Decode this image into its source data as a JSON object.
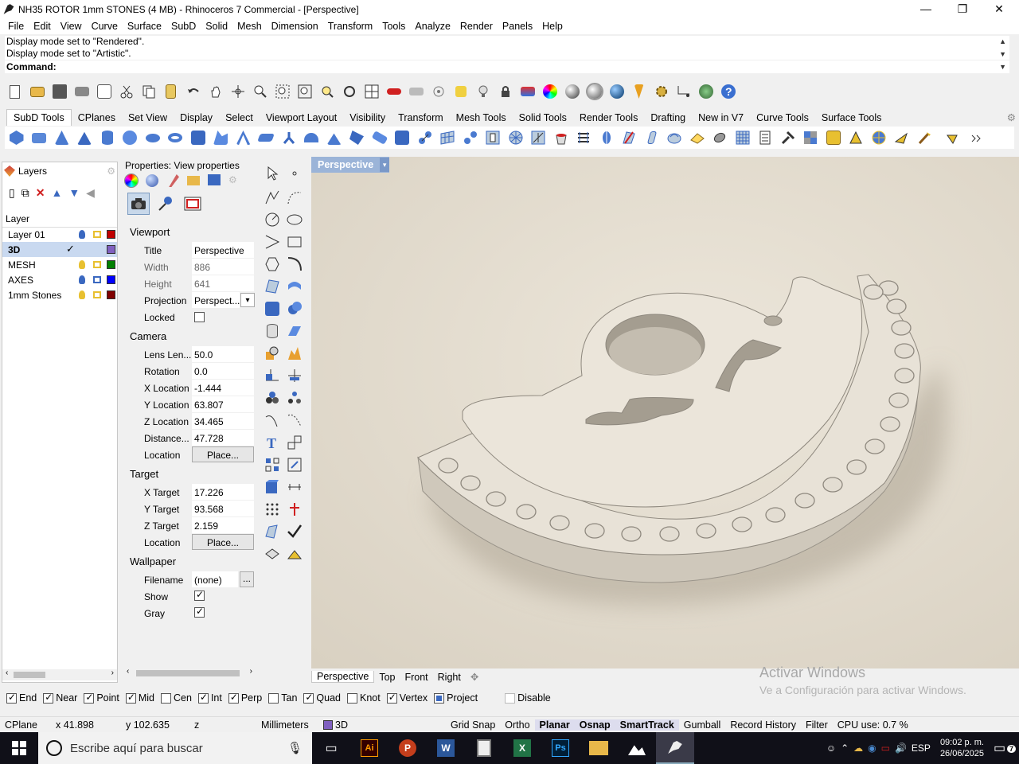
{
  "window": {
    "title": "NH35 ROTOR 1mm STONES (4 MB) - Rhinoceros 7 Commercial - [Perspective]",
    "minimize": "—",
    "maximize": "❐",
    "close": "✕"
  },
  "menu": [
    "File",
    "Edit",
    "View",
    "Curve",
    "Surface",
    "SubD",
    "Solid",
    "Mesh",
    "Dimension",
    "Transform",
    "Tools",
    "Analyze",
    "Render",
    "Panels",
    "Help"
  ],
  "command_history": [
    "Display mode set to \"Rendered\".",
    "Display mode set to \"Artistic\"."
  ],
  "command_prompt": "Command:",
  "toolbar_tabs": [
    "SubD Tools",
    "CPlanes",
    "Set View",
    "Display",
    "Select",
    "Viewport Layout",
    "Visibility",
    "Transform",
    "Mesh Tools",
    "Solid Tools",
    "Render Tools",
    "Drafting",
    "New in V7",
    "Curve Tools",
    "Surface Tools"
  ],
  "layers_panel": {
    "title": "Layers",
    "header": "Layer",
    "rows": [
      {
        "name": "Layer 01",
        "color": "#c00000",
        "current": false
      },
      {
        "name": "3D",
        "color": "#8060c0",
        "current": true
      },
      {
        "name": "MESH",
        "color": "#008000",
        "current": false
      },
      {
        "name": "AXES",
        "color": "#0000ff",
        "current": false
      },
      {
        "name": "1mm Stones",
        "color": "#800000",
        "current": false
      }
    ]
  },
  "properties": {
    "title": "Properties: View properties",
    "viewport_section": "Viewport",
    "title_label": "Title",
    "title_value": "Perspective",
    "width_label": "Width",
    "width_value": "886",
    "height_label": "Height",
    "height_value": "641",
    "projection_label": "Projection",
    "projection_value": "Perspect...",
    "locked_label": "Locked",
    "camera_section": "Camera",
    "lens_label": "Lens Len...",
    "lens_value": "50.0",
    "rotation_label": "Rotation",
    "rotation_value": "0.0",
    "xloc_label": "X Location",
    "xloc_value": "-1.444",
    "yloc_label": "Y Location",
    "yloc_value": "63.807",
    "zloc_label": "Z Location",
    "zloc_value": "34.465",
    "dist_label": "Distance...",
    "dist_value": "47.728",
    "location_label": "Location",
    "place_button": "Place...",
    "target_section": "Target",
    "xtgt_label": "X Target",
    "xtgt_value": "17.226",
    "ytgt_label": "Y Target",
    "ytgt_value": "93.568",
    "ztgt_label": "Z Target",
    "ztgt_value": "2.159",
    "wallpaper_section": "Wallpaper",
    "filename_label": "Filename",
    "filename_value": "(none)",
    "browse_button": "...",
    "show_label": "Show",
    "gray_label": "Gray"
  },
  "viewport": {
    "label": "Perspective",
    "watermark_title": "Activar Windows",
    "watermark_sub": "Ve a Configuración para activar Windows."
  },
  "viewport_tabs": [
    "Perspective",
    "Top",
    "Front",
    "Right"
  ],
  "osnaps": [
    {
      "label": "End",
      "on": true
    },
    {
      "label": "Near",
      "on": true
    },
    {
      "label": "Point",
      "on": true
    },
    {
      "label": "Mid",
      "on": true
    },
    {
      "label": "Cen",
      "on": false
    },
    {
      "label": "Int",
      "on": true
    },
    {
      "label": "Perp",
      "on": true
    },
    {
      "label": "Tan",
      "on": false
    },
    {
      "label": "Quad",
      "on": true
    },
    {
      "label": "Knot",
      "on": false
    },
    {
      "label": "Vertex",
      "on": true
    },
    {
      "label": "Project",
      "on": true
    },
    {
      "label": "Disable",
      "on": false
    }
  ],
  "status": {
    "cplane": "CPlane",
    "x": "x 41.898",
    "y": "y 102.635",
    "z": "z",
    "units": "Millimeters",
    "layer": "3D",
    "grid_snap": "Grid Snap",
    "ortho": "Ortho",
    "planar": "Planar",
    "osnap": "Osnap",
    "smarttrack": "SmartTrack",
    "gumball": "Gumball",
    "record_history": "Record History",
    "filter": "Filter",
    "cpu": "CPU use: 0.7 %"
  },
  "taskbar": {
    "search_placeholder": "Escribe aquí para buscar",
    "lang": "ESP",
    "time": "09:02 p. m.",
    "date": "26/06/2025",
    "notif_count": "7"
  }
}
